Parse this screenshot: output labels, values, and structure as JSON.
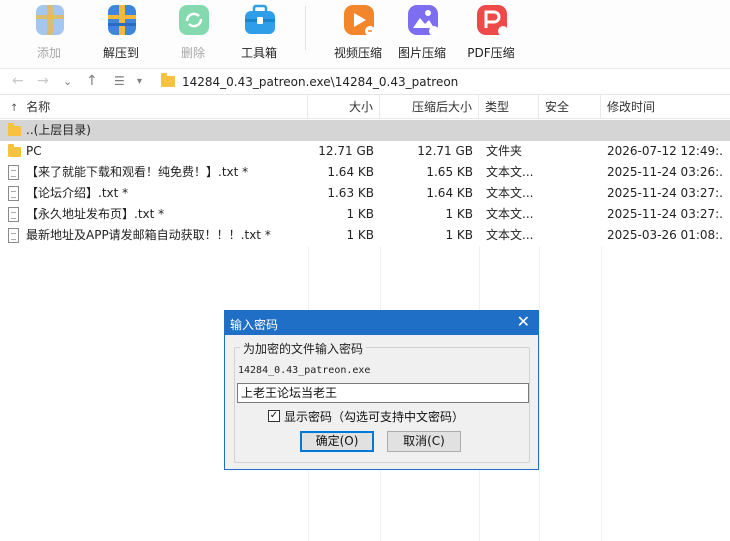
{
  "toolbar": {
    "items": [
      {
        "label": "添加",
        "icon": "add-archive-icon",
        "color": "#4a8fe0",
        "disabled": true
      },
      {
        "label": "解压到",
        "icon": "extract-archive-icon",
        "color": "#3c86dd",
        "disabled": false
      },
      {
        "label": "删除",
        "icon": "recycle-icon",
        "color": "#2dbe74",
        "disabled": true
      },
      {
        "label": "工具箱",
        "icon": "toolbox-icon",
        "color": "#33a0e8",
        "disabled": false
      },
      {
        "label": "视频压缩",
        "icon": "video-compress-icon",
        "color": "#f08a24",
        "disabled": false
      },
      {
        "label": "图片压缩",
        "icon": "image-compress-icon",
        "color": "#7f6ff0",
        "disabled": false
      },
      {
        "label": "PDF压缩",
        "icon": "pdf-compress-icon",
        "color": "#ef4b4b",
        "disabled": false
      }
    ]
  },
  "address": {
    "path": "14284_0.43_patreon.exe\\14284_0.43_patreon"
  },
  "columns": {
    "name": "名称",
    "size": "大小",
    "packed": "压缩后大小",
    "type": "类型",
    "security": "安全",
    "modified": "修改时间"
  },
  "rows": [
    {
      "name": "..(上层目录)",
      "size": "",
      "packed": "",
      "type": "",
      "security": "",
      "modified": "",
      "icon": "folder-icon"
    },
    {
      "name": "PC",
      "size": "12.71 GB",
      "packed": "12.71 GB",
      "type": "文件夹",
      "security": "",
      "modified": "2026-07-12 12:49:...",
      "icon": "folder-icon"
    },
    {
      "name": "【来了就能下载和观看！纯免费！】.txt *",
      "size": "1.64 KB",
      "packed": "1.65 KB",
      "type": "文本文...",
      "security": "",
      "modified": "2025-11-24 03:26:...",
      "icon": "text-file-icon"
    },
    {
      "name": "【论坛介绍】.txt *",
      "size": "1.63 KB",
      "packed": "1.64 KB",
      "type": "文本文...",
      "security": "",
      "modified": "2025-11-24 03:27:...",
      "icon": "text-file-icon"
    },
    {
      "name": "【永久地址发布页】.txt *",
      "size": "1 KB",
      "packed": "1 KB",
      "type": "文本文...",
      "security": "",
      "modified": "2025-11-24 03:27:...",
      "icon": "text-file-icon"
    },
    {
      "name": "最新地址及APP请发邮箱自动获取！！！.txt *",
      "size": "1 KB",
      "packed": "1 KB",
      "type": "文本文...",
      "security": "",
      "modified": "2025-03-26 01:08:...",
      "icon": "text-file-icon"
    }
  ],
  "dialog": {
    "title": "输入密码",
    "group_label": "为加密的文件输入密码",
    "filename": "14284_0.43_patreon.exe",
    "password": "上老王论坛当老王",
    "show_password_label": "显示密码（勾选可支持中文密码）",
    "show_password_checked": true,
    "ok_label": "确定(O)",
    "cancel_label": "取消(C)"
  }
}
